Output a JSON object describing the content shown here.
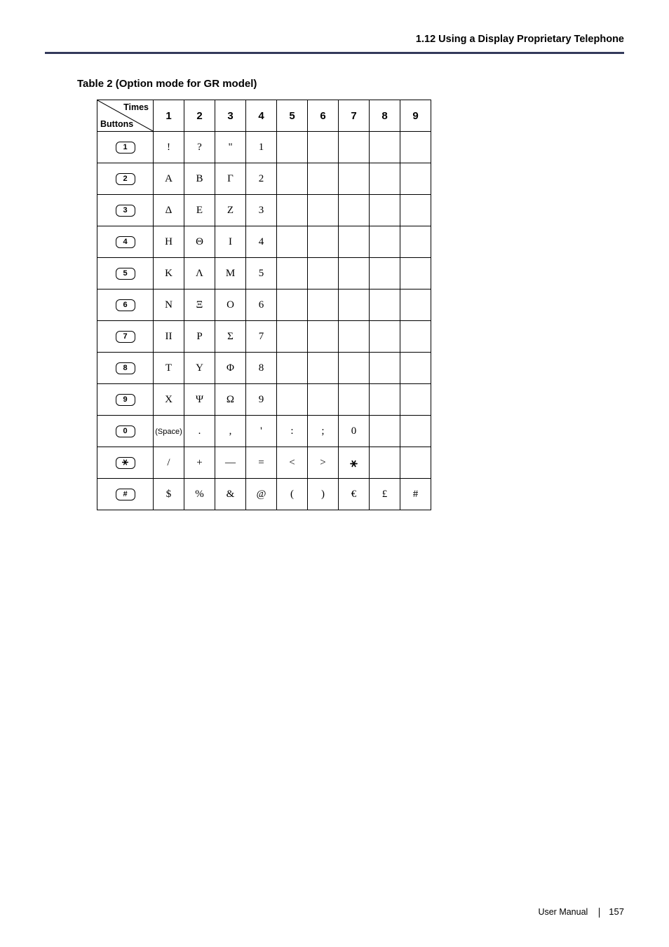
{
  "header": {
    "section": "1.12 Using a Display Proprietary Telephone"
  },
  "table": {
    "title": "Table 2 (Option mode for GR model)",
    "diag": {
      "top": "Times",
      "bottom": "Buttons"
    },
    "cols": [
      "1",
      "2",
      "3",
      "4",
      "5",
      "6",
      "7",
      "8",
      "9"
    ],
    "rows": [
      {
        "key": "1",
        "cells": [
          "!",
          "?",
          "\"",
          "1",
          "",
          "",
          "",
          "",
          ""
        ]
      },
      {
        "key": "2",
        "cells": [
          "Α",
          "Β",
          "Γ",
          "2",
          "",
          "",
          "",
          "",
          ""
        ]
      },
      {
        "key": "3",
        "cells": [
          "Δ",
          "Ε",
          "Ζ",
          "3",
          "",
          "",
          "",
          "",
          ""
        ]
      },
      {
        "key": "4",
        "cells": [
          "Η",
          "Θ",
          "Ι",
          "4",
          "",
          "",
          "",
          "",
          ""
        ]
      },
      {
        "key": "5",
        "cells": [
          "Κ",
          "Λ",
          "Μ",
          "5",
          "",
          "",
          "",
          "",
          ""
        ]
      },
      {
        "key": "6",
        "cells": [
          "Ν",
          "Ξ",
          "Ο",
          "6",
          "",
          "",
          "",
          "",
          ""
        ]
      },
      {
        "key": "7",
        "cells": [
          "ΙΙ",
          "Ρ",
          "Σ",
          "7",
          "",
          "",
          "",
          "",
          ""
        ]
      },
      {
        "key": "8",
        "cells": [
          "Τ",
          "Υ",
          "Φ",
          "8",
          "",
          "",
          "",
          "",
          ""
        ]
      },
      {
        "key": "9",
        "cells": [
          "Χ",
          "Ψ",
          "Ω",
          "9",
          "",
          "",
          "",
          "",
          ""
        ]
      },
      {
        "key": "0",
        "cells": [
          "(Space)",
          ".",
          ",",
          "'",
          ":",
          ";",
          "0",
          "",
          ""
        ]
      },
      {
        "key": "star",
        "cells": [
          "/",
          "+",
          "—",
          "=",
          "<",
          ">",
          "★",
          "",
          ""
        ]
      },
      {
        "key": "hash",
        "cells": [
          "$",
          "%",
          "&",
          "@",
          "(",
          ")",
          "€",
          "£",
          "#"
        ]
      }
    ]
  },
  "footer": {
    "label": "User Manual",
    "page": "157"
  }
}
